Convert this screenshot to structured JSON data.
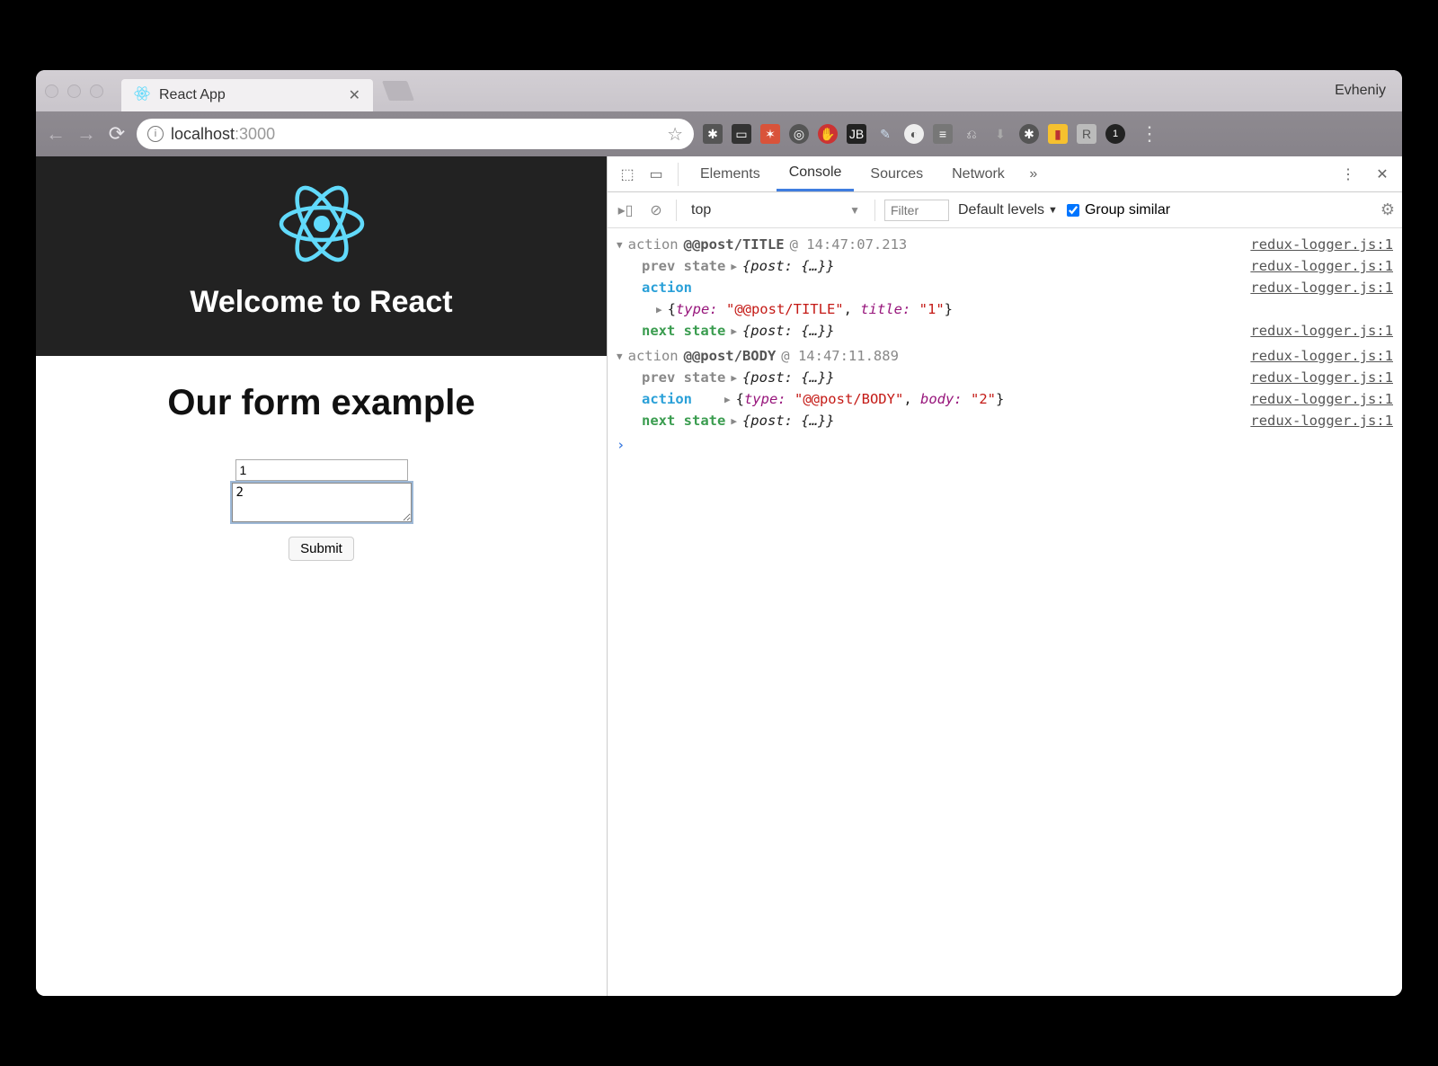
{
  "chrome": {
    "tab_title": "React App",
    "profile_name": "Evheniy",
    "url_host": "localhost",
    "url_path": ":3000"
  },
  "page": {
    "header_title": "Welcome to React",
    "body_title": "Our form example",
    "input_value": "1",
    "textarea_value": "2",
    "submit_label": "Submit"
  },
  "devtools": {
    "tabs": [
      "Elements",
      "Console",
      "Sources",
      "Network"
    ],
    "active_tab": "Console",
    "context": "top",
    "filter_placeholder": "Filter",
    "levels_label": "Default levels",
    "group_similar_label": "Group similar",
    "logs": [
      {
        "action_label": "action",
        "action_type": "@@post/TITLE",
        "timestamp": "@ 14:47:07.213",
        "source": "redux-logger.js:1",
        "prev_state": "{post: {…}}",
        "action_obj_type": "\"@@post/TITLE\"",
        "action_obj_key": "title:",
        "action_obj_val": "\"1\"",
        "next_state": "{post: {…}}"
      },
      {
        "action_label": "action",
        "action_type": "@@post/BODY",
        "timestamp": "@ 14:47:11.889",
        "source": "redux-logger.js:1",
        "prev_state": "{post: {…}}",
        "action_obj_type": "\"@@post/BODY\"",
        "action_obj_key": "body:",
        "action_obj_val": "\"2\"",
        "next_state": "{post: {…}}"
      }
    ],
    "labels": {
      "prev_state": "prev state",
      "action": "action",
      "next_state": "next state",
      "type_key": "type:"
    }
  }
}
